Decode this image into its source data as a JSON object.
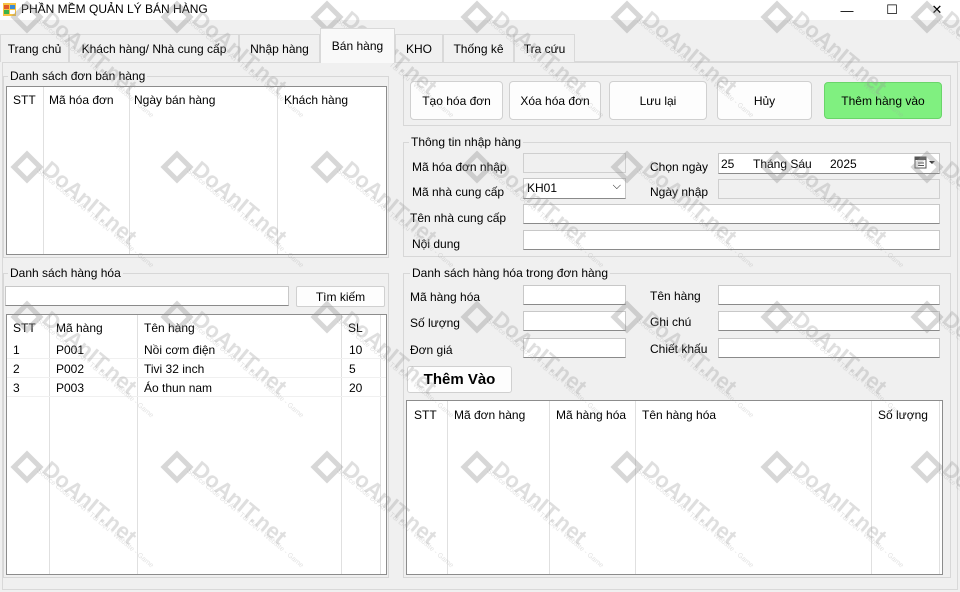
{
  "window": {
    "title": "PHẦN MỀM QUẢN LÝ BÁN HÀNG",
    "minimize": "—",
    "maximize": "☐",
    "close": "✕"
  },
  "tabs": [
    {
      "label": "Trang chủ"
    },
    {
      "label": "Khách hàng/ Nhà cung cấp"
    },
    {
      "label": "Nhập hàng"
    },
    {
      "label": "Bán hàng"
    },
    {
      "label": "KHO"
    },
    {
      "label": "Thống kê"
    },
    {
      "label": "Tra cứu"
    }
  ],
  "active_tab": "Bán hàng",
  "orders_list": {
    "title": "Danh sách đơn bán hàng",
    "columns": [
      "STT",
      "Mã hóa đơn",
      "Ngày bán hàng",
      "Khách hàng"
    ]
  },
  "products_list": {
    "title": "Danh sách hàng hóa",
    "search_value": "",
    "search_button": "Tìm kiếm",
    "columns": [
      "STT",
      "Mã hàng",
      "Tên hàng",
      "SL"
    ],
    "rows": [
      [
        "1",
        "P001",
        "Nồi cơm điện",
        "10"
      ],
      [
        "2",
        "P002",
        "Tivi 32 inch",
        "5"
      ],
      [
        "3",
        "P003",
        "Áo thun nam",
        "20"
      ]
    ]
  },
  "toolbar": {
    "create": "Tạo hóa đơn",
    "delete": "Xóa hóa đơn",
    "save": "Lưu lại",
    "cancel": "Hủy",
    "add_goods": "Thêm hàng vào",
    "add_goods_color": "#80f080"
  },
  "import_info": {
    "title": "Thông tin nhập hàng",
    "invoice_label": "Mã hóa đơn nhập",
    "invoice_value": "",
    "supplier_code_label": "Mã nhà cung cấp",
    "supplier_code_value": "KH01",
    "supplier_name_label": "Tên nhà cung cấp",
    "supplier_name_value": "",
    "content_label": "Nội dung",
    "content_value": "",
    "date_pick_label": "Chọn ngày",
    "date_day": "25",
    "date_month": "Tháng Sáu",
    "date_year": "2025",
    "import_date_label": "Ngày nhập",
    "import_date_value": ""
  },
  "order_items": {
    "title": "Danh sách hàng hóa trong đơn hàng",
    "code_label": "Mã hàng hóa",
    "qty_label": "Số lượng",
    "price_label": "Đơn giá",
    "name_label": "Tên hàng",
    "note_label": "Ghi chú",
    "discount_label": "Chiết khấu",
    "add_button": "Thêm Vào",
    "columns": [
      "STT",
      "Mã đơn hàng",
      "Mã hàng hóa",
      "Tên hàng hóa",
      "Số lượng"
    ]
  },
  "watermark": {
    "brand": "DoAnIT.net",
    "tagline": "Source Code Đồ Án - Tài Liệu - Website - Game"
  }
}
